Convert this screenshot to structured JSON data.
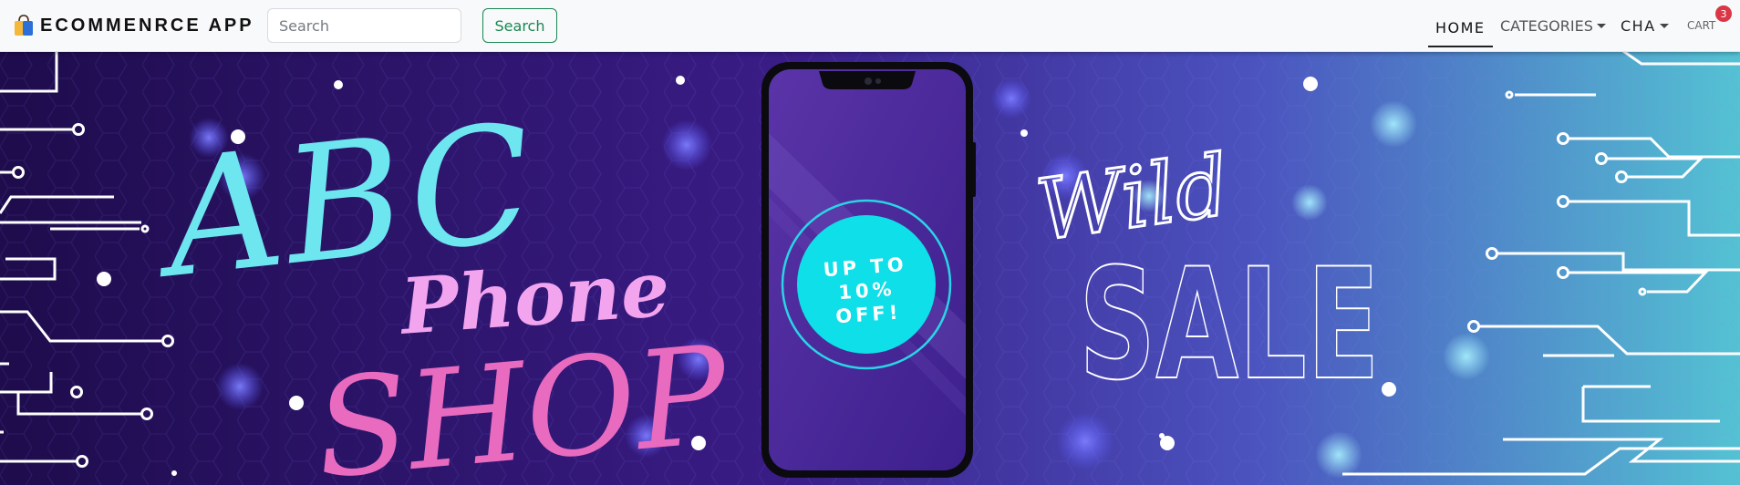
{
  "navbar": {
    "brand": {
      "icon": "shopping-bag-icon",
      "name": "ECOMMENRCE APP"
    },
    "search": {
      "placeholder": "Search",
      "value": "",
      "button_label": "Search"
    },
    "links": [
      {
        "label": "HOME",
        "active": true
      },
      {
        "label": "CATEGORIES",
        "dropdown": true
      },
      {
        "label": "CHA",
        "dropdown": true
      },
      {
        "label": "CART",
        "badge": "3"
      }
    ]
  },
  "banner": {
    "title_script": "ABC",
    "title_mid": "Phone",
    "title_shop": "SHOP",
    "offer": [
      "UP TO",
      "10%",
      "OFF!"
    ],
    "sale_script": "Wild",
    "sale_big": "SALE"
  },
  "colors": {
    "success": "#198754",
    "badge": "#dc3545",
    "banner_dark": "#1e0c4c",
    "banner_light": "#54c2d3",
    "cyan": "#6de6f0",
    "pink": "#e96bc0"
  }
}
